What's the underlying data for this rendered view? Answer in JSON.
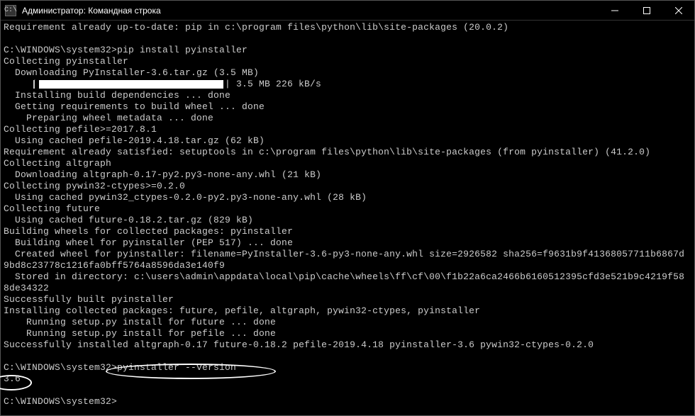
{
  "window": {
    "title": "Администратор: Командная строка",
    "icon_label": "C:\\"
  },
  "progress": {
    "text": "| 3.5 MB 226 kB/s"
  },
  "lines": [
    "Requirement already up-to-date: pip in c:\\program files\\python\\lib\\site-packages (20.0.2)",
    "",
    "C:\\WINDOWS\\system32>pip install pyinstaller",
    "Collecting pyinstaller",
    "  Downloading PyInstaller-3.6.tar.gz (3.5 MB)",
    "__PROGRESS__",
    "  Installing build dependencies ... done",
    "  Getting requirements to build wheel ... done",
    "    Preparing wheel metadata ... done",
    "Collecting pefile>=2017.8.1",
    "  Using cached pefile-2019.4.18.tar.gz (62 kB)",
    "Requirement already satisfied: setuptools in c:\\program files\\python\\lib\\site-packages (from pyinstaller) (41.2.0)",
    "Collecting altgraph",
    "  Downloading altgraph-0.17-py2.py3-none-any.whl (21 kB)",
    "Collecting pywin32-ctypes>=0.2.0",
    "  Using cached pywin32_ctypes-0.2.0-py2.py3-none-any.whl (28 kB)",
    "Collecting future",
    "  Using cached future-0.18.2.tar.gz (829 kB)",
    "Building wheels for collected packages: pyinstaller",
    "  Building wheel for pyinstaller (PEP 517) ... done",
    "  Created wheel for pyinstaller: filename=PyInstaller-3.6-py3-none-any.whl size=2926582 sha256=f9631b9f41368057711b6867d",
    "9bd8c23778c1216fa0bff5764a8596da3e140f9",
    "  Stored in directory: c:\\users\\admin\\appdata\\local\\pip\\cache\\wheels\\ff\\cf\\00\\f1b22a6ca2466b6160512395cfd3e521b9c4219f58",
    "8de34322",
    "Successfully built pyinstaller",
    "Installing collected packages: future, pefile, altgraph, pywin32-ctypes, pyinstaller",
    "    Running setup.py install for future ... done",
    "    Running setup.py install for pefile ... done",
    "Successfully installed altgraph-0.17 future-0.18.2 pefile-2019.4.18 pyinstaller-3.6 pywin32-ctypes-0.2.0",
    "",
    "C:\\WINDOWS\\system32>pyinstaller --version",
    "3.6",
    "",
    "C:\\WINDOWS\\system32>"
  ]
}
